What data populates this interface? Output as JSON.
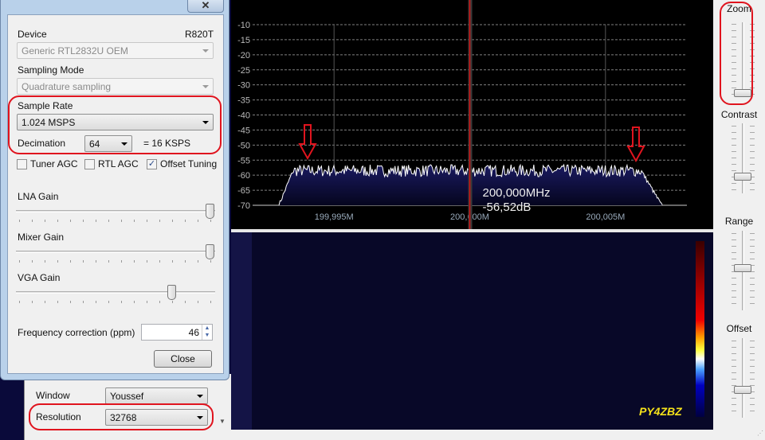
{
  "dialog": {
    "close_x": "✕",
    "device_label": "Device",
    "tuner": "R820T",
    "device_value": "Generic RTL2832U OEM",
    "sampling_mode_label": "Sampling Mode",
    "sampling_mode_value": "Quadrature sampling",
    "sample_rate_label": "Sample Rate",
    "sample_rate_value": "1.024 MSPS",
    "decimation_label": "Decimation",
    "decimation_value": "64",
    "decimation_result": "= 16 KSPS",
    "tuner_agc": {
      "label": "Tuner AGC",
      "checked": false
    },
    "rtl_agc": {
      "label": "RTL AGC",
      "checked": false
    },
    "offset_tuning": {
      "label": "Offset Tuning",
      "checked": true
    },
    "lna_gain_label": "LNA Gain",
    "lna_gain_level": 1.0,
    "mixer_gain_label": "Mixer Gain",
    "mixer_gain_level": 1.0,
    "vga_gain_label": "VGA Gain",
    "vga_gain_level": 0.8,
    "freq_correction_label": "Frequency correction (ppm)",
    "freq_correction_value": "46",
    "close_button": "Close"
  },
  "fft_panel": {
    "window_label": "Window",
    "window_value": "Youssef",
    "resolution_label": "Resolution",
    "resolution_value": "32768"
  },
  "right_panel": {
    "zoom_label": "Zoom",
    "zoom_level": 0.0,
    "contrast_label": "Contrast",
    "contrast_level": 0.3,
    "range_label": "Range",
    "range_level": 0.45,
    "offset_label": "Offset",
    "offset_level": 0.0
  },
  "waterfall": {
    "callsign": "PY4ZBZ"
  },
  "chart_data": {
    "type": "line",
    "title": "",
    "xlabel": "",
    "ylabel": "dB",
    "ylim": [
      -70,
      -10
    ],
    "yticks": [
      "-10",
      "-15",
      "-20",
      "-25",
      "-30",
      "-35",
      "-40",
      "-45",
      "-50",
      "-55",
      "-60",
      "-65",
      "-70"
    ],
    "xlim_mhz": [
      199.992,
      200.008
    ],
    "xticks": [
      {
        "value": 199.995,
        "label": "199,995M"
      },
      {
        "value": 200.0,
        "label": "200,000M"
      },
      {
        "value": 200.005,
        "label": "200,005M"
      }
    ],
    "passband_mhz": [
      199.9935,
      200.0063
    ],
    "noise_floor_db": -59,
    "cursor": {
      "freq_mhz": 200.0,
      "freq_label": "200,000MHz",
      "level_label": "-56,52dB"
    },
    "colors": {
      "trace": "#ffffff",
      "fill": "#0c0c4a",
      "cursor": "#d01010",
      "grid": "#808080"
    }
  }
}
